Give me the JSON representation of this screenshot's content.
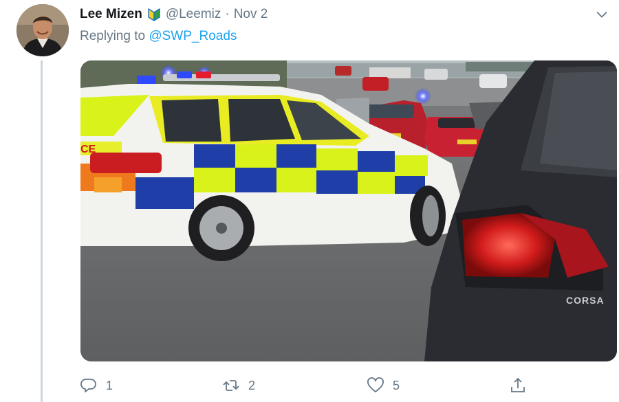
{
  "tweet": {
    "author_name": "Lee Mizen",
    "handle": "@Leemiz",
    "separator": "·",
    "date": "Nov 2",
    "replying_prefix": "Replying to",
    "replying_to": "@SWP_Roads",
    "badge_icon": "beginner-badge-icon",
    "menu_icon": "chevron-down-icon",
    "photo_texts": {
      "police_livery": "CE",
      "car_model": "CORSA"
    }
  },
  "actions": {
    "reply_count": "1",
    "retweet_count": "2",
    "like_count": "5",
    "reply_icon": "reply-icon",
    "retweet_icon": "retweet-icon",
    "like_icon": "heart-icon",
    "share_icon": "share-icon"
  },
  "colors": {
    "link": "#1da1f2",
    "secondary_text": "#657786",
    "police_yellow": "#d9f21a",
    "police_blue": "#1f3ea8"
  }
}
